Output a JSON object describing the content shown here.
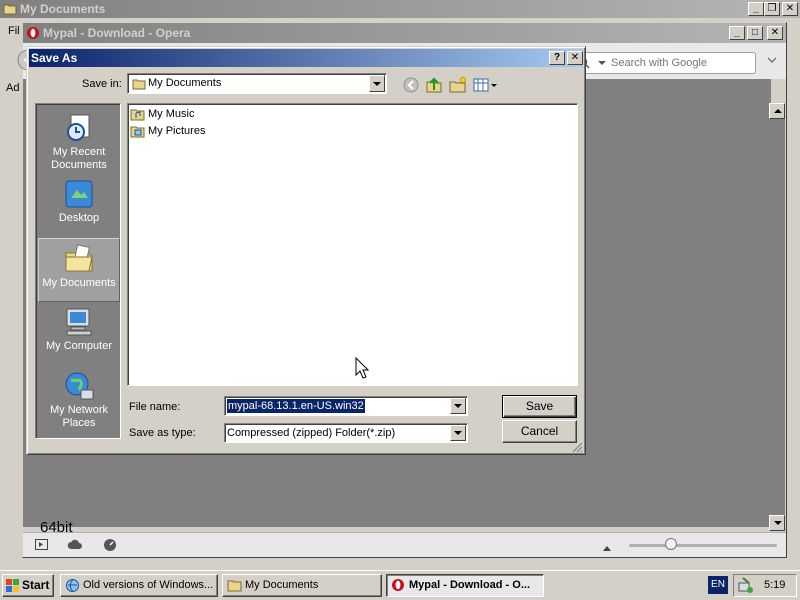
{
  "bg_window": {
    "title": "My Documents",
    "menu_fragment": "Fil",
    "address_fragment": "Ad"
  },
  "opera": {
    "title": "Mypal - Download - Opera",
    "search_placeholder": "Search with Google",
    "page_link": "64bit"
  },
  "dialog": {
    "title": "Save As",
    "help_label": "?",
    "close_label": "✕",
    "save_in_label": "Save in:",
    "save_in_value": "My Documents",
    "places": [
      {
        "label": "My Recent Documents",
        "icon": "recent-documents-icon"
      },
      {
        "label": "Desktop",
        "icon": "desktop-icon"
      },
      {
        "label": "My Documents",
        "icon": "my-documents-icon",
        "selected": true
      },
      {
        "label": "My Computer",
        "icon": "my-computer-icon"
      },
      {
        "label": "My Network Places",
        "icon": "network-places-icon"
      }
    ],
    "files": [
      {
        "name": "My Music",
        "icon": "music-folder-icon"
      },
      {
        "name": "My Pictures",
        "icon": "pictures-folder-icon"
      }
    ],
    "file_name_label": "File name:",
    "file_name_value": "mypal-68.13.1.en-US.win32",
    "save_type_label": "Save as type:",
    "save_type_value": "Compressed (zipped) Folder(*.zip)",
    "save_button": "Save",
    "cancel_button": "Cancel"
  },
  "taskbar": {
    "start_label": "Start",
    "tasks": [
      {
        "label": "Old versions of Windows...",
        "active": false
      },
      {
        "label": "My Documents",
        "active": false
      },
      {
        "label": "Mypal - Download - O...",
        "active": true
      }
    ],
    "language": "EN",
    "clock": "5:19"
  },
  "colors": {
    "title_active": "#0a246a",
    "title_inactive": "#808080",
    "face": "#d4d0c8",
    "selection": "#0a246a"
  }
}
